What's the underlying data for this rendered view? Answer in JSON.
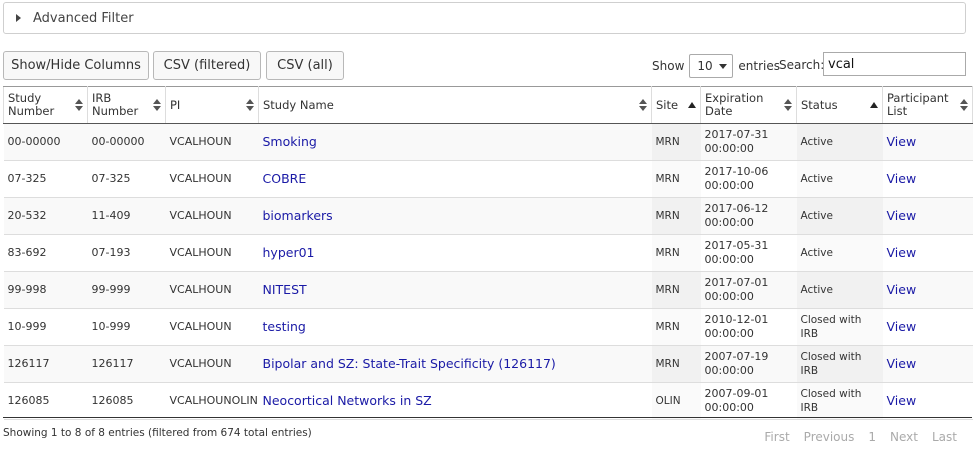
{
  "advanced_filter": {
    "label": "Advanced Filter"
  },
  "toolbar": {
    "show_hide_label": "Show/Hide Columns",
    "csv_filtered_label": "CSV (filtered)",
    "csv_all_label": "CSV (all)"
  },
  "length": {
    "show_label": "Show",
    "value": "10",
    "entries_label": "entries"
  },
  "search": {
    "label": "Search:",
    "value": "vcal"
  },
  "columns": [
    "Study\nNumber",
    "IRB\nNumber",
    "PI",
    "Study Name",
    "Site",
    "Expiration\nDate",
    "Status",
    "Participant\nList"
  ],
  "rows": [
    [
      "00-00000",
      "00-00000",
      "VCALHOUN",
      "Smoking",
      "MRN",
      "2017-07-31\n00:00:00",
      "Active",
      "View"
    ],
    [
      "07-325",
      "07-325",
      "VCALHOUN",
      "COBRE",
      "MRN",
      "2017-10-06\n00:00:00",
      "Active",
      "View"
    ],
    [
      "20-532",
      "11-409",
      "VCALHOUN",
      "biomarkers",
      "MRN",
      "2017-06-12\n00:00:00",
      "Active",
      "View"
    ],
    [
      "83-692",
      "07-193",
      "VCALHOUN",
      "hyper01",
      "MRN",
      "2017-05-31\n00:00:00",
      "Active",
      "View"
    ],
    [
      "99-998",
      "99-999",
      "VCALHOUN",
      "NITEST",
      "MRN",
      "2017-07-01\n00:00:00",
      "Active",
      "View"
    ],
    [
      "10-999",
      "10-999",
      "VCALHOUN",
      "testing",
      "MRN",
      "2010-12-01\n00:00:00",
      "Closed with IRB",
      "View"
    ],
    [
      "126117",
      "126117",
      "VCALHOUN",
      "Bipolar and SZ: State-Trait Specificity (126117)",
      "MRN",
      "2007-07-19\n00:00:00",
      "Closed with IRB",
      "View"
    ],
    [
      "126085",
      "126085",
      "VCALHOUNOLIN",
      "Neocortical Networks in SZ",
      "OLIN",
      "2007-09-01\n00:00:00",
      "Closed with IRB",
      "View"
    ]
  ],
  "info": "Showing 1 to 8 of 8 entries (filtered from 674 total entries)",
  "pager": {
    "first": "First",
    "previous": "Previous",
    "page": "1",
    "next": "Next",
    "last": "Last"
  },
  "colors": {
    "link": "#1a1aa6",
    "pager_disabled": "#aaaaaa"
  }
}
